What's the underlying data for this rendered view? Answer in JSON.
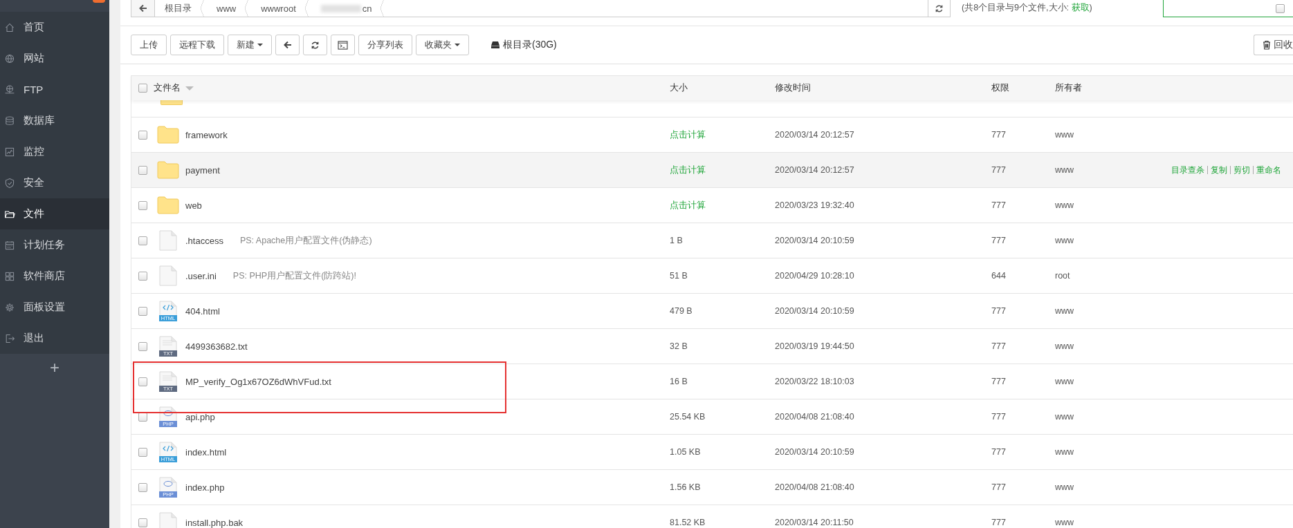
{
  "sidebar": {
    "items": [
      {
        "label": "首页",
        "selected": false
      },
      {
        "label": "网站",
        "selected": false
      },
      {
        "label": "FTP",
        "selected": false
      },
      {
        "label": "数据库",
        "selected": false
      },
      {
        "label": "监控",
        "selected": false
      },
      {
        "label": "安全",
        "selected": false
      },
      {
        "label": "文件",
        "selected": true
      },
      {
        "label": "计划任务",
        "selected": false
      },
      {
        "label": "软件商店",
        "selected": false
      },
      {
        "label": "面板设置",
        "selected": false
      },
      {
        "label": "退出",
        "selected": false
      }
    ],
    "add_label": "+"
  },
  "breadcrumb": {
    "segments": [
      {
        "label": "根目录",
        "blurred": false
      },
      {
        "label": "www",
        "blurred": false
      },
      {
        "label": "wwwroot",
        "blurred": false
      },
      {
        "label": "cn",
        "blurred": true
      }
    ]
  },
  "summary": {
    "prefix": "(共8个目录与9个文件,大小: ",
    "link": "获取",
    "suffix": ")"
  },
  "subdir_option": {
    "checked": false
  },
  "toolbar": {
    "buttons": [
      {
        "kind": "text",
        "label": "上传"
      },
      {
        "kind": "text",
        "label": "远程下载"
      },
      {
        "kind": "dropdown",
        "label": "新建"
      },
      {
        "kind": "back"
      },
      {
        "kind": "refresh"
      },
      {
        "kind": "terminal"
      },
      {
        "kind": "text",
        "label": "分享列表"
      },
      {
        "kind": "dropdown",
        "label": "收藏夹"
      }
    ],
    "disk": "根目录(30G)",
    "recycle": "回收"
  },
  "table": {
    "select_all": {
      "checked": false
    },
    "columns": [
      "文件名",
      "大小",
      "修改时间",
      "权限",
      "所有者"
    ],
    "scrolled_row": {
      "kind": "folder"
    },
    "rows": [
      {
        "kind": "folder",
        "name": "framework",
        "size": "点击计算",
        "time": "2020/03/14 20:12:57",
        "perm": "777",
        "owner": "www",
        "checked": false,
        "highlighted": false
      },
      {
        "kind": "folder",
        "name": "payment",
        "size": "点击计算",
        "time": "2020/03/14 20:12:57",
        "perm": "777",
        "owner": "www",
        "checked": false,
        "highlighted": false,
        "actions": [
          "目录查杀",
          "复制",
          "剪切",
          "重命名"
        ]
      },
      {
        "kind": "folder",
        "name": "web",
        "size": "点击计算",
        "time": "2020/03/23 19:32:40",
        "perm": "777",
        "owner": "www",
        "checked": false,
        "highlighted": false
      },
      {
        "kind": "file",
        "name": ".htaccess",
        "note": "PS: Apache用户配置文件(伪静态)",
        "size": "1 B",
        "time": "2020/03/14 20:10:59",
        "perm": "777",
        "owner": "www",
        "checked": false,
        "highlighted": false
      },
      {
        "kind": "file",
        "name": ".user.ini",
        "note": "PS: PHP用户配置文件(防跨站)!",
        "size": "51 B",
        "time": "2020/04/29 10:28:10",
        "perm": "644",
        "owner": "root",
        "checked": false,
        "highlighted": false
      },
      {
        "kind": "html",
        "badge": "HTML",
        "name": "404.html",
        "size": "479 B",
        "time": "2020/03/14 20:10:59",
        "perm": "777",
        "owner": "www",
        "checked": false,
        "highlighted": false
      },
      {
        "kind": "txt",
        "badge": "TXT",
        "name": "4499363682.txt",
        "size": "32 B",
        "time": "2020/03/19 19:44:50",
        "perm": "777",
        "owner": "www",
        "checked": false,
        "highlighted": false
      },
      {
        "kind": "txt",
        "badge": "TXT",
        "name": "MP_verify_Og1x67OZ6dWhVFud.txt",
        "size": "16 B",
        "time": "2020/03/22 18:10:03",
        "perm": "777",
        "owner": "www",
        "checked": false,
        "highlighted": true
      },
      {
        "kind": "php",
        "badge": "PHP",
        "name": "api.php",
        "size": "25.54 KB",
        "time": "2020/04/08 21:08:40",
        "perm": "777",
        "owner": "www",
        "checked": false,
        "highlighted": false
      },
      {
        "kind": "html",
        "badge": "HTML",
        "name": "index.html",
        "size": "1.05 KB",
        "time": "2020/03/14 20:10:59",
        "perm": "777",
        "owner": "www",
        "checked": false,
        "highlighted": false
      },
      {
        "kind": "php",
        "badge": "PHP",
        "name": "index.php",
        "size": "1.56 KB",
        "time": "2020/04/08 21:08:40",
        "perm": "777",
        "owner": "www",
        "checked": false,
        "highlighted": false
      },
      {
        "kind": "file",
        "name": "install.php.bak",
        "size": "81.52 KB",
        "time": "2020/03/14 20:11:50",
        "perm": "777",
        "owner": "www",
        "checked": false,
        "highlighted": false
      }
    ]
  }
}
